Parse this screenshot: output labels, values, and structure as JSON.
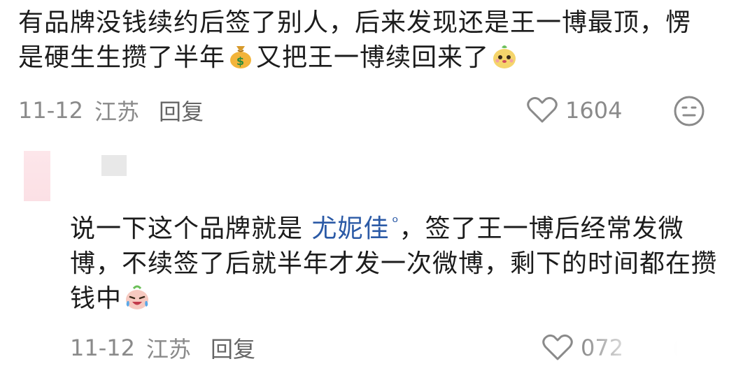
{
  "comments": [
    {
      "text_part1": "有品牌没钱续约后签了别人，后来发现还是王一博最顶，愣是硬生生攒了半年",
      "text_part2": "又把王一博续回来了",
      "emoji1": "money-bag-icon",
      "emoji2": "cute-dog-sticker",
      "date": "11-12",
      "location": "江苏",
      "reply_label": "回复",
      "like_count": "1604"
    },
    {
      "text_prefix": "说一下这个品牌就是",
      "link_text": "尤妮佳",
      "link_icon": "search-icon",
      "text_suffix": "，签了王一博后经常发微博，不续签了后就半年才发一次微博，剩下的时间都在攒钱中",
      "emoji": "crying-laughing-sticker",
      "date": "11-12",
      "location": "江苏",
      "reply_label": "回复",
      "like_count": "072"
    }
  ],
  "colors": {
    "text": "#1c1c1c",
    "meta": "#8a8a8a",
    "link": "#2b5aa6"
  }
}
